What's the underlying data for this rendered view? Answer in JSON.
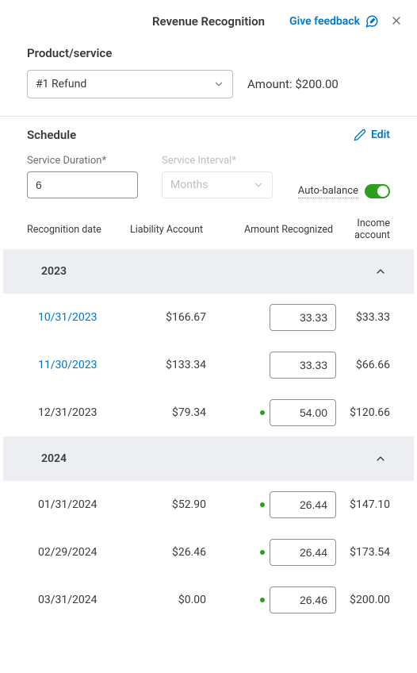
{
  "header": {
    "title": "Revenue Recognition",
    "feedback": "Give feedback"
  },
  "product": {
    "label": "Product/service",
    "selected": "#1 Refund",
    "amount_label": "Amount:",
    "amount_value": "$200.00"
  },
  "schedule": {
    "label": "Schedule",
    "edit": "Edit",
    "duration_label": "Service Duration*",
    "duration_value": "6",
    "interval_label": "Service Interval*",
    "interval_value": "Months",
    "autobalance": "Auto-balance"
  },
  "table": {
    "headers": {
      "date": "Recognition date",
      "liability": "Liability Account",
      "recognized": "Amount Recognized",
      "income": "Income account"
    },
    "groups": [
      {
        "year": "2023",
        "rows": [
          {
            "date": "10/31/2023",
            "link": true,
            "dot": false,
            "liability": "$166.67",
            "recognized": "33.33",
            "income": "$33.33"
          },
          {
            "date": "11/30/2023",
            "link": true,
            "dot": false,
            "liability": "$133.34",
            "recognized": "33.33",
            "income": "$66.66"
          },
          {
            "date": "12/31/2023",
            "link": false,
            "dot": true,
            "liability": "$79.34",
            "recognized": "54.00",
            "income": "$120.66"
          }
        ]
      },
      {
        "year": "2024",
        "rows": [
          {
            "date": "01/31/2024",
            "link": false,
            "dot": true,
            "liability": "$52.90",
            "recognized": "26.44",
            "income": "$147.10"
          },
          {
            "date": "02/29/2024",
            "link": false,
            "dot": true,
            "liability": "$26.46",
            "recognized": "26.44",
            "income": "$173.54"
          },
          {
            "date": "03/31/2024",
            "link": false,
            "dot": true,
            "liability": "$0.00",
            "recognized": "26.46",
            "income": "$200.00"
          }
        ]
      }
    ]
  }
}
